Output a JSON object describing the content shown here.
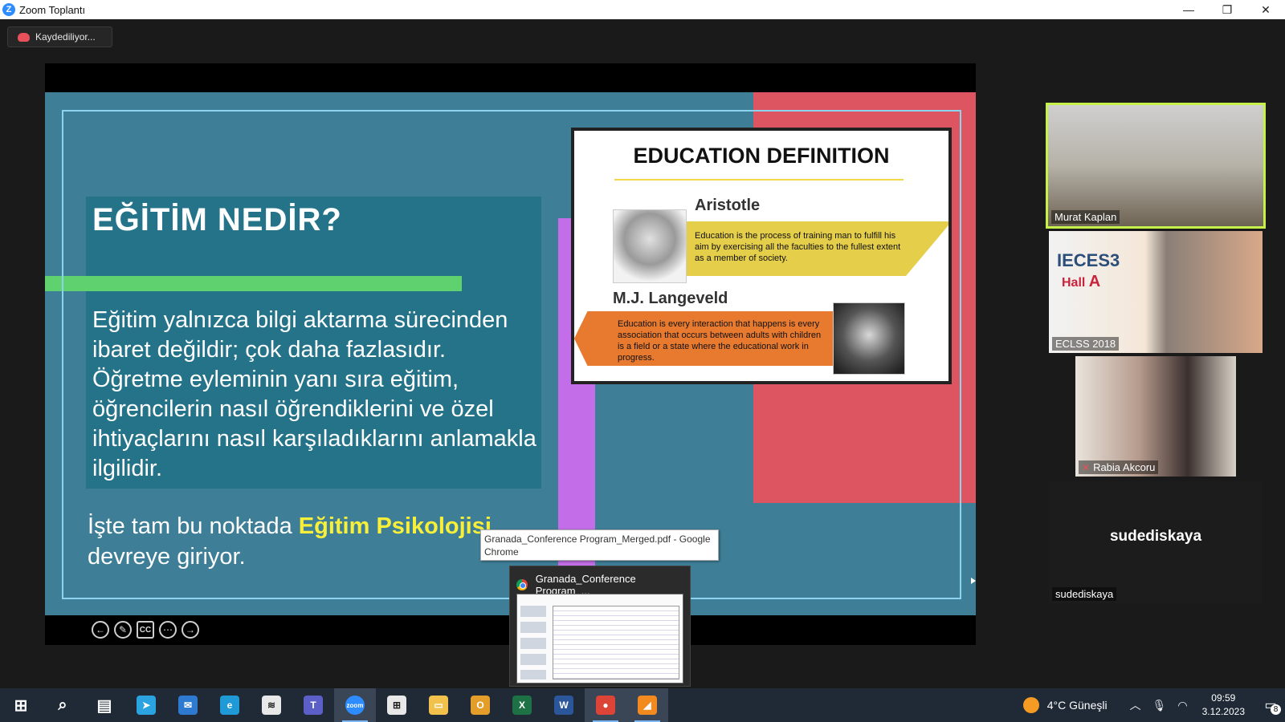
{
  "window": {
    "title": "Zoom Toplantı",
    "minimize_label": "—",
    "restore_label": "❐",
    "close_label": "✕"
  },
  "recording": {
    "label": "Kaydediliyor..."
  },
  "slide": {
    "title": "EĞİTİM NEDİR?",
    "body": "Eğitim yalnızca bilgi aktarma sürecinden ibaret değildir; çok daha fazlasıdır. Öğretme eyleminin yanı sıra eğitim, öğrencilerin nasıl öğrendiklerini ve özel ihtiyaçlarını nasıl karşıladıklarını anlamakla ilgilidir.",
    "footer_prefix": "İşte tam bu noktada",
    "footer_highlight": "Eğitim Psikolojisi",
    "footer_suffix": "devreye giriyor.",
    "card": {
      "heading": "EDUCATION DEFINITION",
      "person1": "Aristotle",
      "quote1": "Education is the process of training man to fulfill his aim by exercising all the faculties to the fullest extent as a member of society.",
      "person2": "M.J. Langeveld",
      "quote2": "Education is every interaction that happens is every association that occurs between adults with children is a field or a state where the educational work in progress."
    },
    "colors": {
      "background": "#3e7f97",
      "red": "#dd5561",
      "purple": "#c36ee8",
      "green": "#5fd26f",
      "highlight": "#f7ef3a"
    }
  },
  "share_toolbar": {
    "prev": "←",
    "pen": "✎",
    "cc": "CC",
    "more": "⋯",
    "next": "→"
  },
  "participants": [
    {
      "name": "Murat Kaplan",
      "active_speaker": true
    },
    {
      "name": "ECLSS 2018",
      "overlay_title": "IECES3",
      "overlay_sub_prefix": "Hall",
      "overlay_sub_letter": "A"
    },
    {
      "name": "Rabia Akcoru",
      "muted": true
    },
    {
      "name": "sudediskaya",
      "center_label": "sudediskaya"
    }
  ],
  "tooltip": {
    "text": "Granada_Conference Program_Merged.pdf - Google Chrome"
  },
  "taskbar_preview": {
    "title": "Granada_Conference Program_..."
  },
  "taskbar": {
    "icons": [
      {
        "name": "start",
        "glyph": "⊞",
        "color": "#1f2a36"
      },
      {
        "name": "search",
        "glyph": "⌕",
        "color": "#1f2a36"
      },
      {
        "name": "task-view",
        "glyph": "▤",
        "color": "#1f2a36"
      },
      {
        "name": "telegram",
        "glyph": "➤",
        "color": "#2aa3e0"
      },
      {
        "name": "mail",
        "glyph": "✉",
        "color": "#2e7ad1"
      },
      {
        "name": "edge",
        "glyph": "e",
        "color": "#1f9ad6"
      },
      {
        "name": "stocks",
        "glyph": "≋",
        "color": "#e8e8e8"
      },
      {
        "name": "teams",
        "glyph": "T",
        "color": "#5b5fc7"
      },
      {
        "name": "zoom",
        "glyph": "zoom",
        "color": "#2d8cff",
        "active": true
      },
      {
        "name": "store",
        "glyph": "⊞",
        "color": "#e8e8e8"
      },
      {
        "name": "file-explorer",
        "glyph": "▭",
        "color": "#f2c14b"
      },
      {
        "name": "outlook",
        "glyph": "O",
        "color": "#e39d28"
      },
      {
        "name": "excel",
        "glyph": "X",
        "color": "#1e7145"
      },
      {
        "name": "word",
        "glyph": "W",
        "color": "#2b579a"
      },
      {
        "name": "chrome",
        "glyph": "●",
        "color": "#db4437",
        "active": true
      },
      {
        "name": "app-orange",
        "glyph": "◢",
        "color": "#f28a20",
        "active": true
      }
    ],
    "weather": "4°C  Güneşli",
    "time": "09:59",
    "date": "3.12.2023",
    "notifications": "8"
  }
}
